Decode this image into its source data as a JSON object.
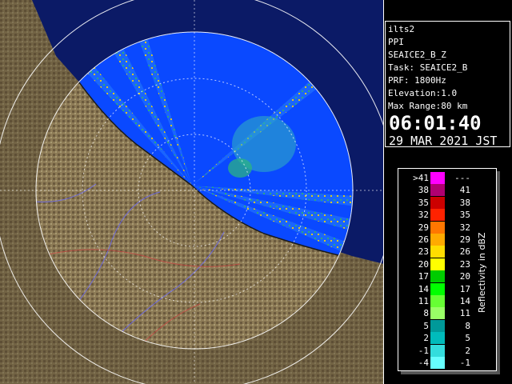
{
  "radar": {
    "site": "ilts2",
    "product": "PPI",
    "product_name": "SEAICE2_B_Z",
    "task": "Task: SEAICE2_B",
    "prf": "PRF: 1800Hz",
    "elevation": "Elevation:1.0",
    "max_range": "Max Range:80 km",
    "time": "06:01:40",
    "date": "29 MAR 2021 JST"
  },
  "legend": {
    "unit_label": "Reflectivity in dBZ",
    "rows": [
      {
        "low": ">41",
        "high": "---",
        "color": "#ff00ff"
      },
      {
        "low": "38",
        "high": "41",
        "color": "#b00070"
      },
      {
        "low": "35",
        "high": "38",
        "color": "#cc0000"
      },
      {
        "low": "32",
        "high": "35",
        "color": "#ff2200"
      },
      {
        "low": "29",
        "high": "32",
        "color": "#ff7700"
      },
      {
        "low": "26",
        "high": "29",
        "color": "#ffaa00"
      },
      {
        "low": "23",
        "high": "26",
        "color": "#ffdd00"
      },
      {
        "low": "20",
        "high": "23",
        "color": "#ffff00"
      },
      {
        "low": "17",
        "high": "20",
        "color": "#00cc00"
      },
      {
        "low": "14",
        "high": "17",
        "color": "#00ff00"
      },
      {
        "low": "11",
        "high": "14",
        "color": "#66ff33"
      },
      {
        "low": "8",
        "high": "11",
        "color": "#99ff66"
      },
      {
        "low": "5",
        "high": "8",
        "color": "#009999"
      },
      {
        "low": "2",
        "high": "5",
        "color": "#00bbbb"
      },
      {
        "low": "-1",
        "high": "2",
        "color": "#33dddd"
      },
      {
        "low": "-4",
        "high": "-1",
        "color": "#66ffff"
      }
    ]
  },
  "colors": {
    "sea": "#0a49ff",
    "land": "#8a7a58",
    "range_ring": "#ffffff",
    "background": "#000000"
  }
}
